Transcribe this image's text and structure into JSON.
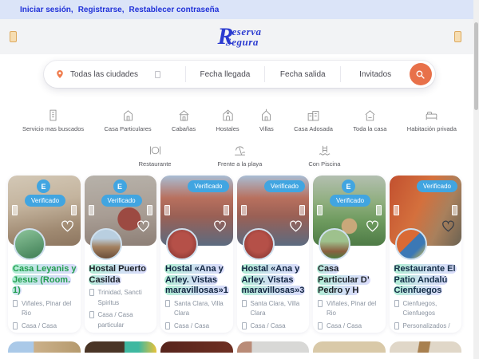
{
  "topbar": {
    "links": [
      {
        "label": "Iniciar sesión,"
      },
      {
        "label": "Registrarse,"
      },
      {
        "label": "Restablecer contraseña"
      }
    ]
  },
  "logo": {
    "r": "R",
    "word_top": "eserva",
    "s": "S",
    "word_bottom": "egura"
  },
  "search": {
    "location": "Todas las ciudades",
    "checkin": "Fecha llegada",
    "checkout": "Fecha salida",
    "guests": "Invitados"
  },
  "categories_row1": [
    {
      "label": "Servicio mas buscados"
    },
    {
      "label": "Casa Particulares"
    },
    {
      "label": "Cabañas"
    },
    {
      "label": "Hostales"
    },
    {
      "label": "Villas"
    },
    {
      "label": "Casa Adosada"
    },
    {
      "label": "Toda la casa"
    },
    {
      "label": "Habitación privada"
    }
  ],
  "categories_row2": [
    {
      "label": "Restaurante"
    },
    {
      "label": "Frente a la playa"
    },
    {
      "label": "Con Piscina"
    }
  ],
  "labels": {
    "verified": "Verificado",
    "badge_e": "E"
  },
  "cards": [
    {
      "title": "Casa Leyanis y Jesus (Room. 1)",
      "title_color": "#239e4f",
      "has_badge_e": true,
      "heart": "light",
      "location": "Viñales, Pinar del Rio",
      "type": "Casa / Casa particular"
    },
    {
      "title": "Hostal Puerto Casilda",
      "title_color": "#1b2026",
      "has_badge_e": true,
      "heart": "light",
      "location": "Trinidad, Sancti Spiritus",
      "type": "Casa / Casa particular"
    },
    {
      "title": "Hostal «Ana y Arley. Vistas maravillosas»1",
      "title_color": "#10233f",
      "has_badge_e": false,
      "heart": "light",
      "location": "Santa Clara, Villa Clara",
      "type": "Casa / Casa particular"
    },
    {
      "title": "Hostal «Ana y Arley. Vistas maravillosas»3",
      "title_color": "#10233f",
      "has_badge_e": false,
      "heart": "light",
      "location": "Santa Clara, Villa Clara",
      "type": "Casa / Casa particular"
    },
    {
      "title": "Casa Particular D’ Pedro y H",
      "title_color": "#1b2026",
      "has_badge_e": true,
      "heart": "light",
      "location": "Viñales, Pinar del Rio",
      "type": "Casa / Casa Adosada"
    },
    {
      "title": "Restaurante El Patio Andalú Cienfuegos",
      "title_color": "#132c46",
      "has_badge_e": false,
      "heart": "dark",
      "location": "Cienfuegos, Cienfuegos",
      "type": "Personalizados / Restaurante"
    }
  ],
  "colors": {
    "accent_orange": "#e8714a",
    "badge_blue": "#41a5e1",
    "link_blue": "#2031d8",
    "logo_blue": "#2b3bd0"
  }
}
